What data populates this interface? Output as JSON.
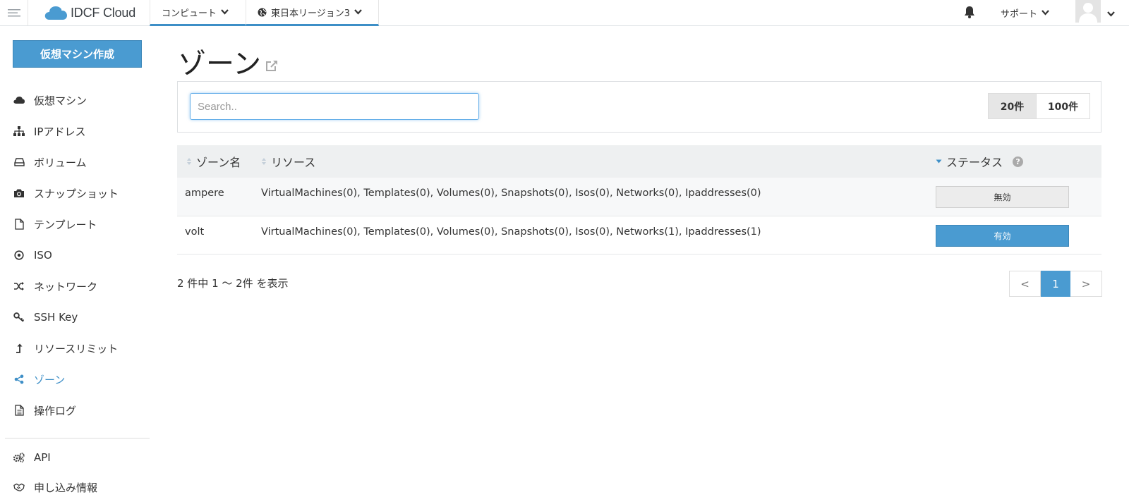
{
  "topbar": {
    "brand": "IDCF Cloud",
    "compute_label": "コンピュート",
    "region_label": "東日本リージョン3",
    "support_label": "サポート"
  },
  "sidebar": {
    "create_button": "仮想マシン作成",
    "items": [
      {
        "label": "仮想マシン",
        "icon": "cloud-icon"
      },
      {
        "label": "IPアドレス",
        "icon": "sitemap-icon"
      },
      {
        "label": "ボリューム",
        "icon": "hdd-icon"
      },
      {
        "label": "スナップショット",
        "icon": "camera-icon"
      },
      {
        "label": "テンプレート",
        "icon": "file-icon"
      },
      {
        "label": "ISO",
        "icon": "disc-icon"
      },
      {
        "label": "ネットワーク",
        "icon": "random-icon"
      },
      {
        "label": "SSH Key",
        "icon": "key-icon"
      },
      {
        "label": "リソースリミット",
        "icon": "level-up-icon"
      },
      {
        "label": "ゾーン",
        "icon": "share-icon"
      },
      {
        "label": "操作ログ",
        "icon": "log-file-icon"
      },
      {
        "label": "API",
        "icon": "gears-icon"
      },
      {
        "label": "申し込み情報",
        "icon": "handshake-icon"
      }
    ],
    "active_index": 9
  },
  "main": {
    "title": "ゾーン",
    "search_placeholder": "Search..",
    "page_size_options": [
      "20件",
      "100件"
    ],
    "selected_page_size": "20件",
    "columns": [
      "ゾーン名",
      "リソース",
      "ステータス"
    ],
    "rows": [
      {
        "zone": "ampere",
        "resources": "VirtualMachines(0), Templates(0), Volumes(0), Snapshots(0), Isos(0), Networks(0), Ipaddresses(0)",
        "status": "無効"
      },
      {
        "zone": "volt",
        "resources": "VirtualMachines(0), Templates(0), Volumes(0), Snapshots(0), Isos(0), Networks(1), Ipaddresses(1)",
        "status": "有効"
      }
    ],
    "summary": "2 件中 1 〜 2件 を表示",
    "pager": {
      "prev": "<",
      "current": "1",
      "next": ">"
    }
  },
  "colors": {
    "accent": "#4a9bd1",
    "header_bg": "#eef0f1",
    "disabled_bg": "#ececec"
  }
}
